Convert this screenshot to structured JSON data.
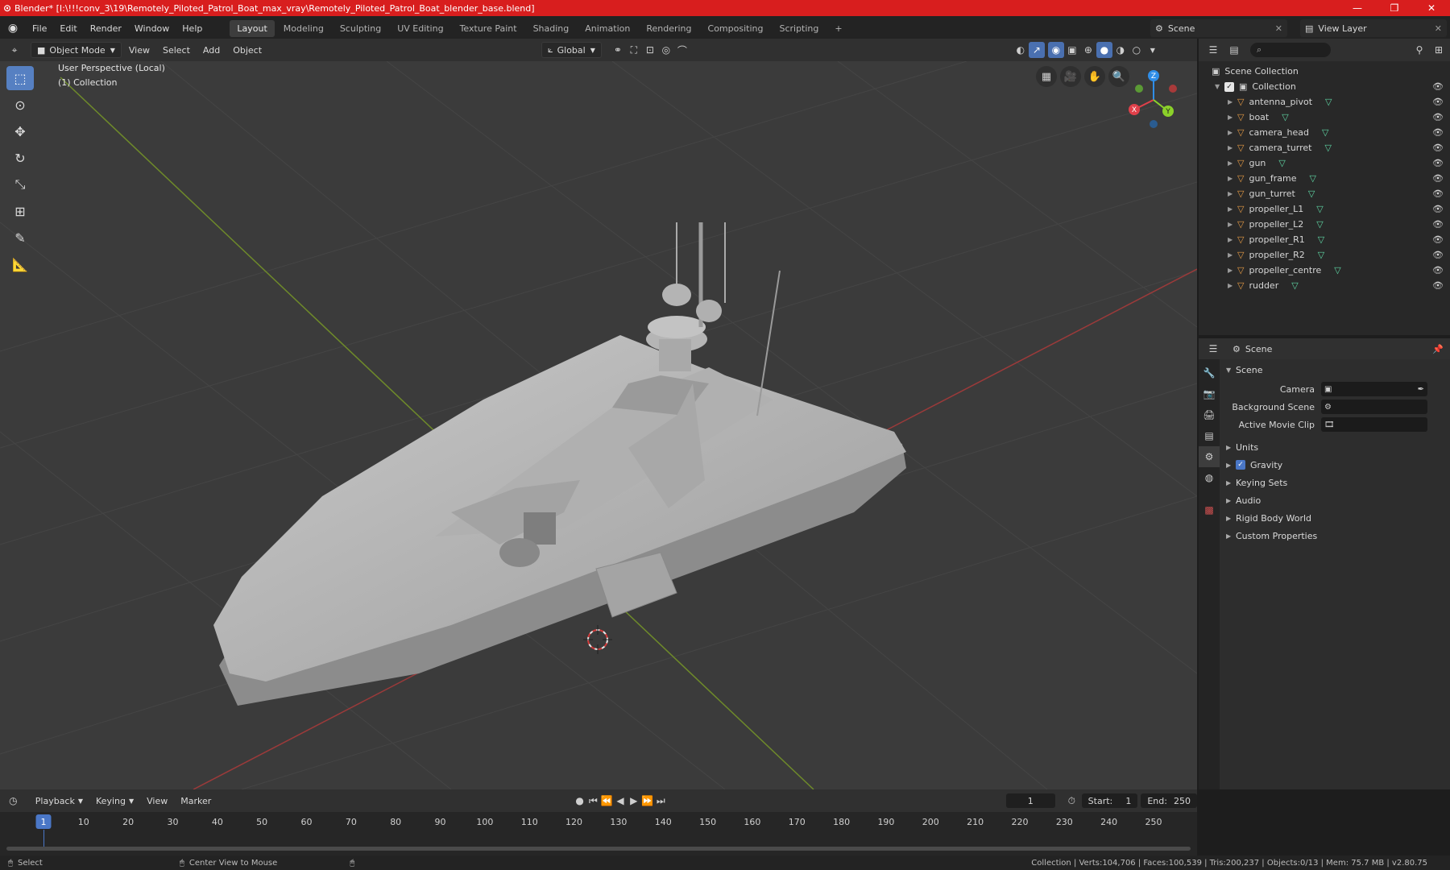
{
  "window": {
    "title": "Blender* [I:\\!!!conv_3\\19\\Remotely_Piloted_Patrol_Boat_max_vray\\Remotely_Piloted_Patrol_Boat_blender_base.blend]"
  },
  "menu": [
    "File",
    "Edit",
    "Render",
    "Window",
    "Help"
  ],
  "workspaces": [
    "Layout",
    "Modeling",
    "Sculpting",
    "UV Editing",
    "Texture Paint",
    "Shading",
    "Animation",
    "Rendering",
    "Compositing",
    "Scripting"
  ],
  "active_workspace": "Layout",
  "scene_selector": "Scene",
  "view_layer": "View Layer",
  "viewport_header": {
    "mode": "Object Mode",
    "view": "View",
    "select": "Select",
    "add": "Add",
    "object": "Object",
    "orientation": "Global"
  },
  "viewport": {
    "perspective": "User Perspective (Local)",
    "collection": "(1) Collection"
  },
  "gizmo": {
    "z": "Z",
    "x": "X",
    "y": "Y"
  },
  "outliner": {
    "root": "Scene Collection",
    "collection": "Collection",
    "objects": [
      "antenna_pivot",
      "boat",
      "camera_head",
      "camera_turret",
      "gun",
      "gun_frame",
      "gun_turret",
      "propeller_L1",
      "propeller_L2",
      "propeller_R1",
      "propeller_R2",
      "propeller_centre",
      "rudder"
    ]
  },
  "properties": {
    "header": "Scene",
    "section": "Scene",
    "fields": [
      {
        "label": "Camera"
      },
      {
        "label": "Background Scene"
      },
      {
        "label": "Active Movie Clip"
      }
    ],
    "subsections": [
      "Units",
      "Gravity",
      "Keying Sets",
      "Audio",
      "Rigid Body World",
      "Custom Properties"
    ],
    "gravity_checked": true
  },
  "timeline": {
    "menus": [
      "Playback",
      "Keying",
      "View",
      "Marker"
    ],
    "current_frame": "1",
    "start_label": "Start:",
    "start": "1",
    "end_label": "End:",
    "end": "250",
    "ticks": [
      "1",
      "10",
      "20",
      "30",
      "40",
      "50",
      "60",
      "70",
      "80",
      "90",
      "100",
      "110",
      "120",
      "130",
      "140",
      "150",
      "160",
      "170",
      "180",
      "190",
      "200",
      "210",
      "220",
      "230",
      "240",
      "250"
    ]
  },
  "status": {
    "left": "Select",
    "middle": "Center View to Mouse",
    "right": "Collection | Verts:104,706 | Faces:100,539 | Tris:200,237 | Objects:0/13 | Mem: 75.7 MB | v2.80.75"
  },
  "colors": {
    "title_bar": "#d81e1e",
    "accent": "#4a77c7",
    "object_icon": "#e59a44",
    "mesh_icon": "#5fd6a4",
    "x_axis": "#e0404a",
    "y_axis": "#8bd12a",
    "z_axis": "#2f8ee8"
  }
}
